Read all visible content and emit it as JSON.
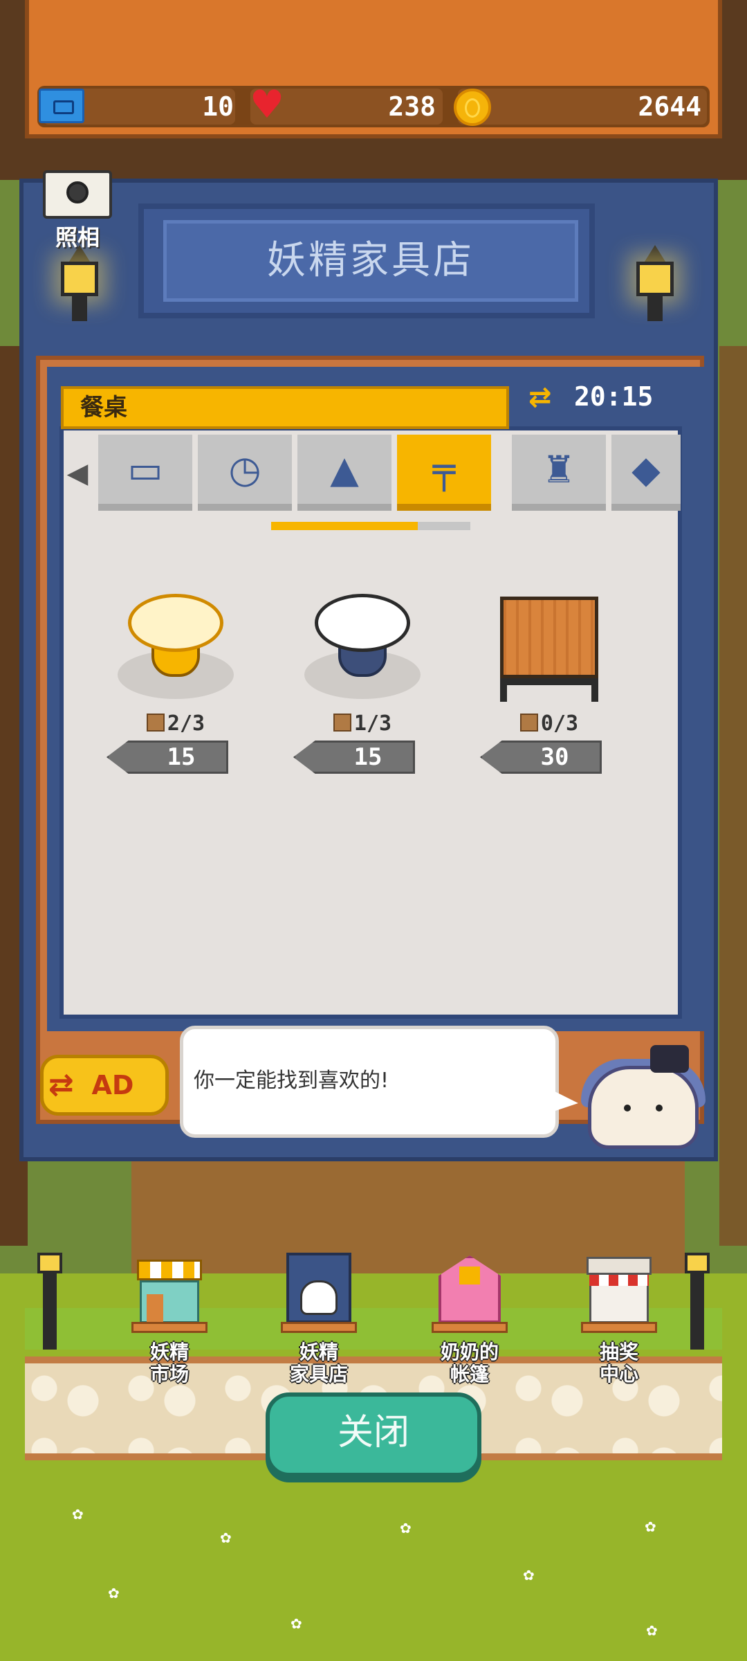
{
  "status_bar": {
    "tickets": "10",
    "hearts": "238",
    "coins": "2644"
  },
  "camera": {
    "label": "照相"
  },
  "shop": {
    "title": "妖精家具店",
    "category": "餐桌",
    "timer": "20:15",
    "tabs": [
      {
        "icon": "sofa-icon",
        "glyph": "▭"
      },
      {
        "icon": "clock-icon",
        "glyph": "◷"
      },
      {
        "icon": "ceiling-lamp-icon",
        "glyph": "▲"
      },
      {
        "icon": "table-icon",
        "glyph": "╤"
      },
      {
        "icon": "chair-icon",
        "glyph": "♜"
      },
      {
        "icon": "partial-tab-icon",
        "glyph": "◆"
      }
    ],
    "active_tab": 3,
    "items": [
      {
        "name": "yellow-round-table",
        "stock": "2/3",
        "price": "15",
        "color": "#ffe08a"
      },
      {
        "name": "white-round-table",
        "stock": "1/3",
        "price": "15",
        "color": "#ffffff"
      },
      {
        "name": "wooden-square-table",
        "stock": "0/3",
        "price": "30",
        "color": "#d9843c"
      }
    ]
  },
  "ad_button": {
    "label": "AD"
  },
  "npc_speech": "你一定能找到喜欢的!",
  "bottom_nav": [
    {
      "id": "fairy-market",
      "line1": "妖精",
      "line2": "市场"
    },
    {
      "id": "fairy-furniture-shop",
      "line1": "妖精",
      "line2": "家具店"
    },
    {
      "id": "grandma-tent",
      "line1": "奶奶的",
      "line2": "帐篷"
    },
    {
      "id": "lottery-center",
      "line1": "抽奖",
      "line2": "中心"
    }
  ],
  "close_button": {
    "label": "关闭"
  },
  "colors": {
    "panel_blue": "#3b5487",
    "accent_yellow": "#f7b500",
    "close_green": "#3bb89a"
  }
}
